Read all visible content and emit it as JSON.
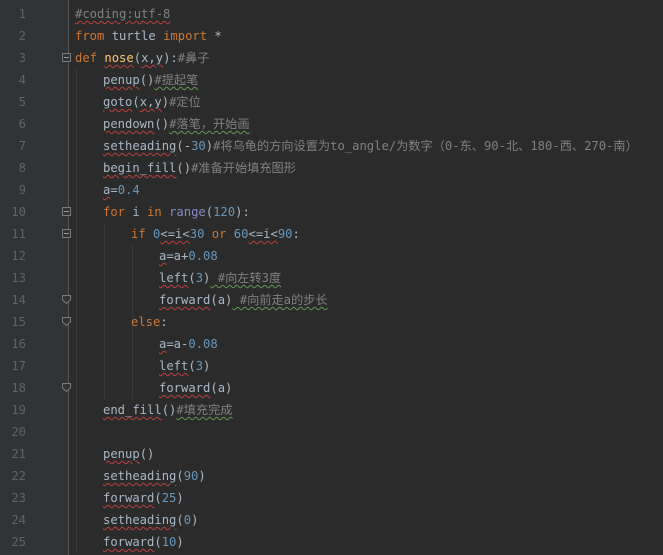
{
  "editor": {
    "lines": [
      {
        "n": "1",
        "segments": [
          {
            "t": "#coding:utf-8",
            "c": "cmt squiggle"
          }
        ]
      },
      {
        "n": "2",
        "segments": [
          {
            "t": "from",
            "c": "kw"
          },
          {
            "t": " turtle ",
            "c": "tok"
          },
          {
            "t": "import",
            "c": "kw"
          },
          {
            "t": " *",
            "c": "tok"
          }
        ]
      },
      {
        "n": "3",
        "segments": [
          {
            "t": "def",
            "c": "kw"
          },
          {
            "t": " ",
            "c": "tok"
          },
          {
            "t": "nose",
            "c": "fn-def squiggle"
          },
          {
            "t": "(",
            "c": "tok"
          },
          {
            "t": "x,y",
            "c": "tok squiggle"
          },
          {
            "t": "):",
            "c": "tok"
          },
          {
            "t": "#鼻子",
            "c": "cmt"
          }
        ]
      },
      {
        "n": "4",
        "segments": [
          {
            "t": "penup",
            "c": "tok squiggle"
          },
          {
            "t": "()",
            "c": "tok"
          },
          {
            "t": "#提起笔",
            "c": "cmt squiggle-green"
          }
        ]
      },
      {
        "n": "5",
        "segments": [
          {
            "t": "goto",
            "c": "tok squiggle"
          },
          {
            "t": "(",
            "c": "tok"
          },
          {
            "t": "x,y",
            "c": "tok squiggle"
          },
          {
            "t": ")",
            "c": "tok"
          },
          {
            "t": "#定位",
            "c": "cmt"
          }
        ]
      },
      {
        "n": "6",
        "segments": [
          {
            "t": "pendown",
            "c": "tok squiggle"
          },
          {
            "t": "()",
            "c": "tok"
          },
          {
            "t": "#落笔，开始画",
            "c": "cmt squiggle-green"
          }
        ]
      },
      {
        "n": "7",
        "segments": [
          {
            "t": "setheading",
            "c": "tok squiggle"
          },
          {
            "t": "(-",
            "c": "tok"
          },
          {
            "t": "30",
            "c": "num"
          },
          {
            "t": ")",
            "c": "tok"
          },
          {
            "t": "#将乌龟的方向设置为to_angle/为数字（0-东、90-北、180-西、270-南）",
            "c": "cmt"
          }
        ]
      },
      {
        "n": "8",
        "segments": [
          {
            "t": "begin_fill",
            "c": "tok squiggle"
          },
          {
            "t": "()",
            "c": "tok"
          },
          {
            "t": "#准备开始填充图形",
            "c": "cmt"
          }
        ]
      },
      {
        "n": "9",
        "segments": [
          {
            "t": "a",
            "c": "tok squiggle"
          },
          {
            "t": "=",
            "c": "tok"
          },
          {
            "t": "0.4",
            "c": "num"
          }
        ]
      },
      {
        "n": "10",
        "segments": [
          {
            "t": "for",
            "c": "kw"
          },
          {
            "t": " i ",
            "c": "tok"
          },
          {
            "t": "in",
            "c": "kw"
          },
          {
            "t": " ",
            "c": "tok"
          },
          {
            "t": "range",
            "c": "builtin"
          },
          {
            "t": "(",
            "c": "tok"
          },
          {
            "t": "120",
            "c": "num"
          },
          {
            "t": "):",
            "c": "tok"
          }
        ]
      },
      {
        "n": "11",
        "segments": [
          {
            "t": "if",
            "c": "kw"
          },
          {
            "t": " ",
            "c": "tok"
          },
          {
            "t": "0",
            "c": "num"
          },
          {
            "t": "<=i<",
            "c": "tok squiggle"
          },
          {
            "t": "30",
            "c": "num"
          },
          {
            "t": " ",
            "c": "tok"
          },
          {
            "t": "or",
            "c": "kw"
          },
          {
            "t": " ",
            "c": "tok"
          },
          {
            "t": "60",
            "c": "num"
          },
          {
            "t": "<=i<",
            "c": "tok squiggle"
          },
          {
            "t": "90",
            "c": "num"
          },
          {
            "t": ":",
            "c": "tok"
          }
        ]
      },
      {
        "n": "12",
        "segments": [
          {
            "t": "a",
            "c": "tok squiggle"
          },
          {
            "t": "=a+",
            "c": "tok"
          },
          {
            "t": "0.08",
            "c": "num"
          }
        ]
      },
      {
        "n": "13",
        "segments": [
          {
            "t": "left",
            "c": "tok squiggle"
          },
          {
            "t": "(",
            "c": "tok"
          },
          {
            "t": "3",
            "c": "num"
          },
          {
            "t": ")",
            "c": "tok"
          },
          {
            "t": " #向左转3度",
            "c": "cmt squiggle-green"
          }
        ]
      },
      {
        "n": "14",
        "segments": [
          {
            "t": "forward",
            "c": "tok squiggle"
          },
          {
            "t": "(a)",
            "c": "tok"
          },
          {
            "t": " #向前走a的步长",
            "c": "cmt squiggle-green"
          }
        ]
      },
      {
        "n": "15",
        "segments": [
          {
            "t": "else",
            "c": "kw"
          },
          {
            "t": ":",
            "c": "tok"
          }
        ]
      },
      {
        "n": "16",
        "segments": [
          {
            "t": "a",
            "c": "tok squiggle"
          },
          {
            "t": "=a-",
            "c": "tok"
          },
          {
            "t": "0.08",
            "c": "num"
          }
        ]
      },
      {
        "n": "17",
        "segments": [
          {
            "t": "left",
            "c": "tok squiggle"
          },
          {
            "t": "(",
            "c": "tok"
          },
          {
            "t": "3",
            "c": "num"
          },
          {
            "t": ")",
            "c": "tok"
          }
        ]
      },
      {
        "n": "18",
        "segments": [
          {
            "t": "forward",
            "c": "tok squiggle"
          },
          {
            "t": "(a)",
            "c": "tok"
          }
        ]
      },
      {
        "n": "19",
        "segments": [
          {
            "t": "end_fill",
            "c": "tok squiggle"
          },
          {
            "t": "()",
            "c": "tok"
          },
          {
            "t": "#填充完成",
            "c": "cmt squiggle-green"
          }
        ]
      },
      {
        "n": "20",
        "segments": []
      },
      {
        "n": "21",
        "segments": [
          {
            "t": "penup",
            "c": "tok squiggle"
          },
          {
            "t": "()",
            "c": "tok"
          }
        ]
      },
      {
        "n": "22",
        "segments": [
          {
            "t": "setheading",
            "c": "tok squiggle"
          },
          {
            "t": "(",
            "c": "tok"
          },
          {
            "t": "90",
            "c": "num"
          },
          {
            "t": ")",
            "c": "tok"
          }
        ]
      },
      {
        "n": "23",
        "segments": [
          {
            "t": "forward",
            "c": "tok squiggle"
          },
          {
            "t": "(",
            "c": "tok"
          },
          {
            "t": "25",
            "c": "num"
          },
          {
            "t": ")",
            "c": "tok"
          }
        ]
      },
      {
        "n": "24",
        "segments": [
          {
            "t": "setheading",
            "c": "tok squiggle"
          },
          {
            "t": "(",
            "c": "tok"
          },
          {
            "t": "0",
            "c": "num"
          },
          {
            "t": ")",
            "c": "tok"
          }
        ]
      },
      {
        "n": "25",
        "segments": [
          {
            "t": "forward",
            "c": "tok squiggle"
          },
          {
            "t": "(",
            "c": "tok"
          },
          {
            "t": "10",
            "c": "num"
          },
          {
            "t": ")",
            "c": "tok"
          }
        ]
      }
    ],
    "colors": {
      "background": "#2b2b2b",
      "gutter": "#313335",
      "keyword": "#cc7832",
      "function": "#ffc66d",
      "number": "#6897bb",
      "comment": "#808080",
      "text": "#a9b7c6",
      "builtin": "#8888c6"
    }
  }
}
